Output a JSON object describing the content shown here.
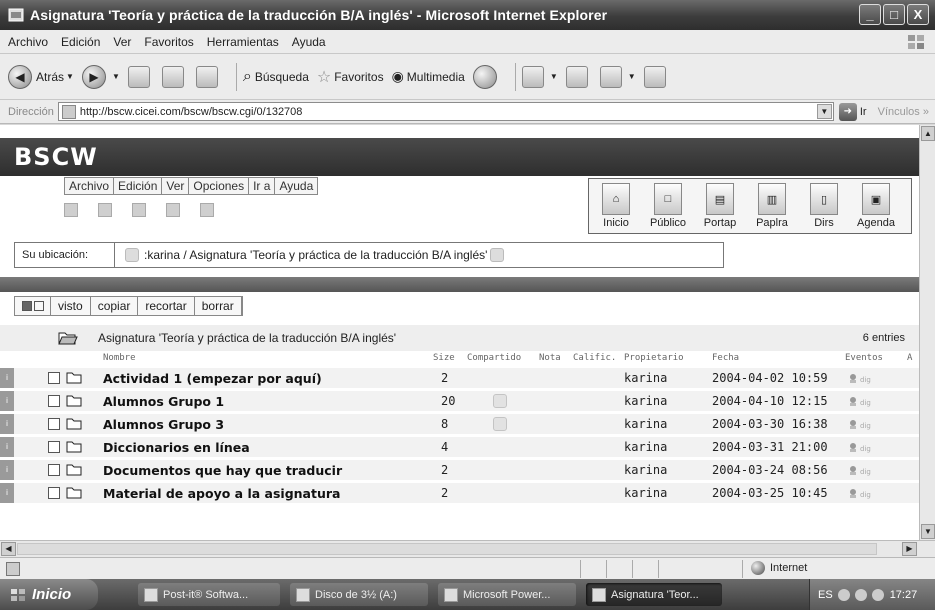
{
  "window": {
    "title": "Asignatura 'Teoría y práctica de la traducción B/A inglés' - Microsoft Internet Explorer",
    "min": "_",
    "max": "□",
    "close": "X"
  },
  "menu": [
    "Archivo",
    "Edición",
    "Ver",
    "Favoritos",
    "Herramientas",
    "Ayuda"
  ],
  "toolbar": {
    "back": "Atrás",
    "search": "Búsqueda",
    "favorites": "Favoritos",
    "multimedia": "Multimedia"
  },
  "address": {
    "label": "Dirección",
    "url": "http://bscw.cicei.com/bscw/bscw.cgi/0/132708",
    "go": "Ir",
    "links": "Vínculos"
  },
  "bscw": {
    "logo": "BSCW",
    "menu": [
      "Archivo",
      "Edición",
      "Ver",
      "Opciones",
      "Ir a",
      "Ayuda"
    ],
    "nav": [
      "Inicio",
      "Público",
      "Portap",
      "Paplra",
      "Dirs",
      "Agenda"
    ],
    "location_label": "Su ubicación:",
    "location_path": ":karina / Asignatura 'Teoría y práctica de la traducción B/A inglés'",
    "actions": [
      "visto",
      "copiar",
      "recortar",
      "borrar"
    ],
    "folder_title": "Asignatura 'Teoría y práctica de la traducción B/A inglés'",
    "entries": "6 entries",
    "columns": [
      "Nombre",
      "Size",
      "Compartido",
      "Nota",
      "Calific.",
      "Propietario",
      "Fecha",
      "Eventos",
      "A"
    ]
  },
  "rows": [
    {
      "name": "Actividad 1 (empezar por aquí)",
      "size": "2",
      "owner": "karina",
      "date": "2004-04-02 10:59",
      "shared": false
    },
    {
      "name": "Alumnos Grupo 1",
      "size": "20",
      "owner": "karina",
      "date": "2004-04-10 12:15",
      "shared": true
    },
    {
      "name": "Alumnos Grupo 3",
      "size": "8",
      "owner": "karina",
      "date": "2004-03-30 16:38",
      "shared": true
    },
    {
      "name": "Diccionarios en línea",
      "size": "4",
      "owner": "karina",
      "date": "2004-03-31 21:00",
      "shared": false
    },
    {
      "name": "Documentos que hay que traducir",
      "size": "2",
      "owner": "karina",
      "date": "2004-03-24 08:56",
      "shared": false
    },
    {
      "name": "Material de apoyo a la asignatura",
      "size": "2",
      "owner": "karina",
      "date": "2004-03-25 10:45",
      "shared": false
    }
  ],
  "status": {
    "zone": "Internet"
  },
  "taskbar": {
    "start": "Inicio",
    "tasks": [
      "Post-it® Softwa...",
      "Disco de 3½ (A:)",
      "Microsoft Power...",
      "Asignatura 'Teor..."
    ],
    "tray_lang": "ES",
    "clock": "17:27"
  }
}
